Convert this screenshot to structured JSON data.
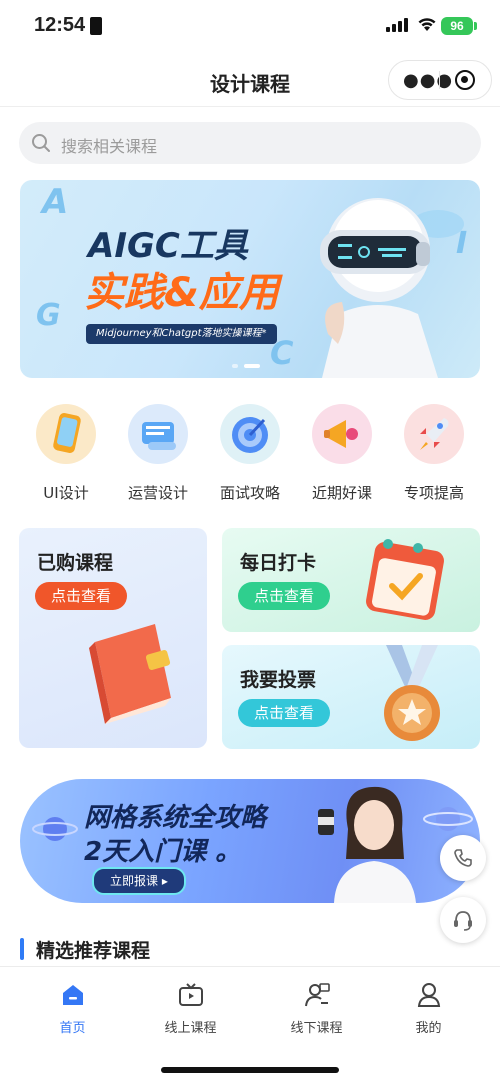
{
  "status": {
    "time": "12:54",
    "battery": "96"
  },
  "nav": {
    "title": "设计课程",
    "more_icon": "more-dots-icon",
    "target_icon": "target-icon"
  },
  "search": {
    "placeholder": "搜索相关课程"
  },
  "banner": {
    "title_line1": "AIGC工具",
    "title_line2": "实践&应用",
    "tagline": "Midjourney和Chatgpt落地实操课程*",
    "letters": [
      "A",
      "G",
      "C",
      "I"
    ]
  },
  "categories": [
    {
      "label": "UI设计",
      "icon": "phone-icon",
      "color": "#fbe9c8"
    },
    {
      "label": "运营设计",
      "icon": "scroll-icon",
      "color": "#dceafb"
    },
    {
      "label": "面试攻略",
      "icon": "target-board-icon",
      "color": "#dff1f6"
    },
    {
      "label": "近期好课",
      "icon": "megaphone-icon",
      "color": "#fadde8"
    },
    {
      "label": "专项提高",
      "icon": "rocket-icon",
      "color": "#fbe0e0"
    }
  ],
  "cards": {
    "purchased": {
      "title": "已购课程",
      "button": "点击查看"
    },
    "checkin": {
      "title": "每日打卡",
      "button": "点击查看"
    },
    "vote": {
      "title": "我要投票",
      "button": "点击查看"
    }
  },
  "promo": {
    "line1": "网格系统全攻略",
    "line2": "2天入门课 。",
    "button": "立即报课 ▸"
  },
  "section": {
    "title": "精选推荐课程"
  },
  "tabs": [
    {
      "label": "首页",
      "icon": "home-icon",
      "active": true
    },
    {
      "label": "线上课程",
      "icon": "tv-icon",
      "active": false
    },
    {
      "label": "线下课程",
      "icon": "teacher-icon",
      "active": false
    },
    {
      "label": "我的",
      "icon": "user-icon",
      "active": false
    }
  ],
  "colors": {
    "accent": "#3477f5",
    "orange_button": "#f0562a",
    "green_button": "#2fcf8e",
    "cyan_button": "#33c7d9"
  }
}
